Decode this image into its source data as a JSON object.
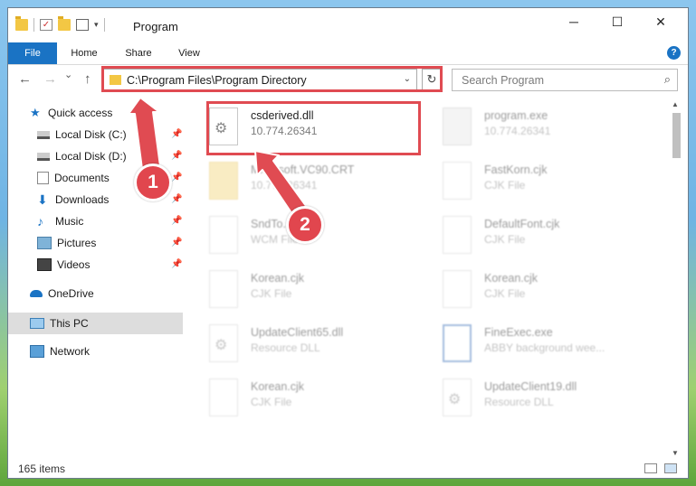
{
  "window": {
    "title": "Program",
    "controls": {
      "minimize": "─",
      "maximize": "☐",
      "close": "✕"
    }
  },
  "ribbon": {
    "tabs": [
      "File",
      "Home",
      "Share",
      "View"
    ],
    "help": "?"
  },
  "nav": {
    "back": "←",
    "forward": "→",
    "dropdown": "⌄",
    "up": "↑",
    "address": "C:\\Program Files\\Program Directory",
    "address_caret": "⌄",
    "refresh": "↻",
    "search_placeholder": "Search Program",
    "search_icon": "⌕"
  },
  "sidebar": {
    "items": [
      {
        "label": "Quick access",
        "icon": "star-icon"
      },
      {
        "label": "Local Disk (C:)",
        "icon": "drive-icon",
        "pinned": true
      },
      {
        "label": "Local Disk (D:)",
        "icon": "drive-icon",
        "pinned": true
      },
      {
        "label": "Documents",
        "icon": "documents-icon",
        "pinned": true
      },
      {
        "label": "Downloads",
        "icon": "downloads-icon",
        "pinned": true
      },
      {
        "label": "Music",
        "icon": "music-icon",
        "pinned": true
      },
      {
        "label": "Pictures",
        "icon": "pictures-icon",
        "pinned": true
      },
      {
        "label": "Videos",
        "icon": "videos-icon",
        "pinned": true
      },
      {
        "label": "OneDrive",
        "icon": "cloud-icon"
      },
      {
        "label": "This PC",
        "icon": "monitor-icon",
        "selected": true
      },
      {
        "label": "Network",
        "icon": "network-icon"
      }
    ],
    "pin_glyph": "📌"
  },
  "files": [
    {
      "name": "csderived.dll",
      "sub": "10.774.26341",
      "icon": "dll-file-icon",
      "highlighted": true
    },
    {
      "name": "program.exe",
      "sub": "10.774.26341",
      "icon": "exe-file-icon"
    },
    {
      "name": "Microsoft.VC90.CRT",
      "sub": "10.774.26341",
      "icon": "folder-icon"
    },
    {
      "name": "FastKorn.cjk",
      "sub": "CJK File",
      "icon": "generic-file-icon"
    },
    {
      "name": "SndTo...wcm",
      "sub": "WCM File",
      "icon": "generic-file-icon"
    },
    {
      "name": "DefaultFont.cjk",
      "sub": "CJK File",
      "icon": "generic-file-icon"
    },
    {
      "name": "Korean.cjk",
      "sub": "CJK File",
      "icon": "generic-file-icon"
    },
    {
      "name": "Korean.cjk",
      "sub": "CJK File",
      "icon": "generic-file-icon"
    },
    {
      "name": "UpdateClient65.dll",
      "sub": "Resource DLL",
      "icon": "dll-file-icon"
    },
    {
      "name": "FineExec.exe",
      "sub": "ABBY background wee...",
      "icon": "exe-file-icon"
    },
    {
      "name": "Korean.cjk",
      "sub": "CJK File",
      "icon": "generic-file-icon"
    },
    {
      "name": "UpdateClient19.dll",
      "sub": "Resource DLL",
      "icon": "dll-file-icon"
    }
  ],
  "status": {
    "item_count": "165 items"
  },
  "annotations": {
    "step1": "1",
    "step2": "2"
  },
  "colors": {
    "accent": "#1a73c4",
    "annotation": "#e04b52",
    "selected_bg": "#dddddd"
  }
}
